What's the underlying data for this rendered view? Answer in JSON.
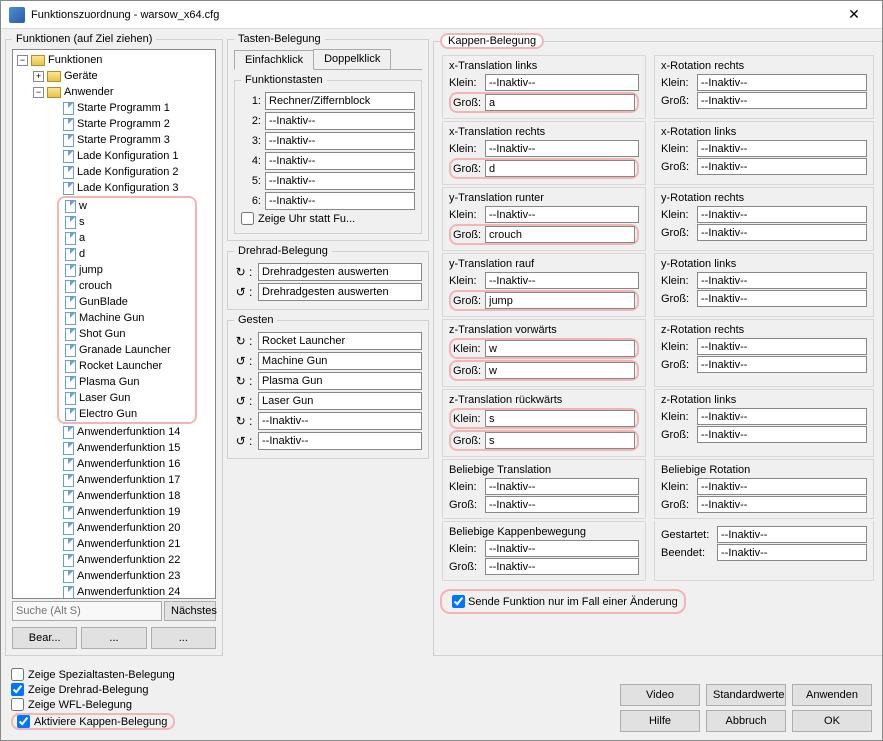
{
  "window": {
    "title": "Funktionszuordnung - warsow_x64.cfg"
  },
  "tree": {
    "header": "Funktionen (auf Ziel ziehen)",
    "root": "Funktionen",
    "geraete": "Geräte",
    "anwender": "Anwender",
    "items": [
      "Starte Programm 1",
      "Starte Programm 2",
      "Starte Programm 3",
      "Lade Konfiguration 1",
      "Lade Konfiguration 2",
      "Lade Konfiguration 3",
      "w",
      "s",
      "a",
      "d",
      "jump",
      "crouch",
      "GunBlade",
      "Machine Gun",
      "Shot Gun",
      "Granade Launcher",
      "Rocket Launcher",
      "Plasma Gun",
      "Laser Gun",
      "Electro Gun",
      "Anwenderfunktion 14",
      "Anwenderfunktion 15",
      "Anwenderfunktion 16",
      "Anwenderfunktion 17",
      "Anwenderfunktion 18",
      "Anwenderfunktion 19",
      "Anwenderfunktion 20",
      "Anwenderfunktion 21",
      "Anwenderfunktion 22",
      "Anwenderfunktion 23",
      "Anwenderfunktion 24"
    ],
    "hl_start": 6,
    "hl_end": 19,
    "search_placeholder": "Suche (Alt S)",
    "next": "Nächstes",
    "bear": "Bear...",
    "dots1": "...",
    "dots2": "..."
  },
  "tasten": {
    "legend": "Tasten-Belegung",
    "tab1": "Einfachklick",
    "tab2": "Doppelklick",
    "fk_legend": "Funktionstasten",
    "fk": [
      "Rechner/Ziffernblock",
      "--Inaktiv--",
      "--Inaktiv--",
      "--Inaktiv--",
      "--Inaktiv--",
      "--Inaktiv--"
    ],
    "clock": "Zeige Uhr statt Fu..."
  },
  "drehrad": {
    "legend": "Drehrad-Belegung",
    "r1": "Drehradgesten auswerten",
    "r2": "Drehradgesten auswerten"
  },
  "gesten": {
    "legend": "Gesten",
    "rows": [
      "Rocket Launcher",
      "Machine Gun",
      "Plasma Gun",
      "Laser Gun",
      "--Inaktiv--",
      "--Inaktiv--"
    ]
  },
  "kappen": {
    "legend": "Kappen-Belegung",
    "klein": "Klein:",
    "gross": "Groß:",
    "gestartet": "Gestartet:",
    "beendet": "Beendet:",
    "inactive": "--Inaktiv--",
    "groups_left": [
      {
        "t": "x-Translation links",
        "k": "--Inaktiv--",
        "g": "a",
        "hl": "g"
      },
      {
        "t": "x-Translation rechts",
        "k": "--Inaktiv--",
        "g": "d",
        "hl": "g"
      },
      {
        "t": "y-Translation runter",
        "k": "--Inaktiv--",
        "g": "crouch",
        "hl": "g"
      },
      {
        "t": "y-Translation rauf",
        "k": "--Inaktiv--",
        "g": "jump",
        "hl": "g"
      },
      {
        "t": "z-Translation vorwärts",
        "k": "w",
        "g": "w",
        "hl": "kg"
      },
      {
        "t": "z-Translation rückwärts",
        "k": "s",
        "g": "s",
        "hl": "kg"
      },
      {
        "t": "Beliebige Translation",
        "k": "--Inaktiv--",
        "g": "--Inaktiv--"
      },
      {
        "t": "Beliebige Kappenbewegung",
        "k": "--Inaktiv--",
        "g": "--Inaktiv--"
      }
    ],
    "groups_right": [
      {
        "t": "x-Rotation rechts",
        "k": "--Inaktiv--",
        "g": "--Inaktiv--"
      },
      {
        "t": "x-Rotation links",
        "k": "--Inaktiv--",
        "g": "--Inaktiv--"
      },
      {
        "t": "y-Rotation rechts",
        "k": "--Inaktiv--",
        "g": "--Inaktiv--"
      },
      {
        "t": "y-Rotation links",
        "k": "--Inaktiv--",
        "g": "--Inaktiv--"
      },
      {
        "t": "z-Rotation rechts",
        "k": "--Inaktiv--",
        "g": "--Inaktiv--"
      },
      {
        "t": "z-Rotation links",
        "k": "--Inaktiv--",
        "g": "--Inaktiv--"
      },
      {
        "t": "Beliebige Rotation",
        "k": "--Inaktiv--",
        "g": "--Inaktiv--"
      }
    ],
    "send": "Sende Funktion nur im Fall einer Änderung"
  },
  "footer": {
    "c1": "Zeige Spezialtasten-Belegung",
    "c2": "Zeige Drehrad-Belegung",
    "c3": "Zeige WFL-Belegung",
    "c4": "Aktiviere Kappen-Belegung",
    "video": "Video",
    "std": "Standardwerte",
    "apply": "Anwenden",
    "help": "Hilfe",
    "cancel": "Abbruch",
    "ok": "OK"
  }
}
